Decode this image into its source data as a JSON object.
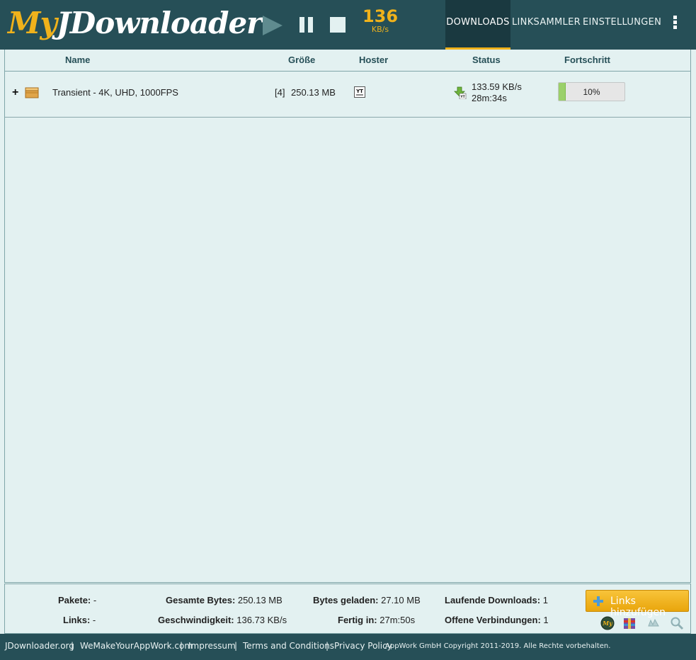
{
  "header": {
    "logo_my": "My",
    "logo_rest": "JDownloader",
    "speed_value": "136",
    "speed_unit": "KB/s",
    "nav": [
      {
        "label": "DOWNLOADS",
        "active": true
      },
      {
        "label": "LINKSAMMLER",
        "active": false
      },
      {
        "label": "EINSTELLUNGEN",
        "active": false
      }
    ]
  },
  "table": {
    "columns": [
      "Name",
      "Größe",
      "Hoster",
      "Status",
      "Fortschritt"
    ],
    "rows": [
      {
        "expand": "+",
        "name": "Transient - 4K, UHD, 1000FPS",
        "count": "[4]",
        "size": "250.13 MB",
        "hoster_icon": "youtube-icon",
        "hoster_text": "YT",
        "status_speed": "133.59 KB/s",
        "status_eta": "28m:34s",
        "progress_text": "10%",
        "progress_fraction": 0.1
      }
    ]
  },
  "summary": {
    "pakete_label": "Pakete:",
    "pakete_value": "-",
    "links_label": "Links:",
    "links_value": "-",
    "gesamte_label": "Gesamte Bytes:",
    "gesamte_value": "250.13 MB",
    "geschw_label": "Geschwindigkeit:",
    "geschw_value": "136.73 KB/s",
    "geladen_label": "Bytes geladen:",
    "geladen_value": "27.10 MB",
    "fertig_label": "Fertig in:",
    "fertig_value": "27m:50s",
    "laufende_label": "Laufende Downloads:",
    "laufende_value": "1",
    "offene_label": "Offene Verbindungen:",
    "offene_value": "1",
    "add_links_label": "Links hinzufügen",
    "tray_icons": [
      "myjdownloader-icon",
      "archive-icon",
      "captcha-icon",
      "search-icon"
    ]
  },
  "footer": {
    "links": [
      "JDownloader.org",
      "WeMakeYourAppWork.com",
      "Impressum",
      "Terms and Conditions",
      "Privacy Policy"
    ],
    "copyright": "AppWork GmbH Copyright 2011-2019. Alle Rechte vorbehalten."
  },
  "colors": {
    "header_bg": "#264f57",
    "accent": "#f0b21b",
    "content_bg": "#e3f1f1",
    "progress_fill": "#9bd06a"
  }
}
